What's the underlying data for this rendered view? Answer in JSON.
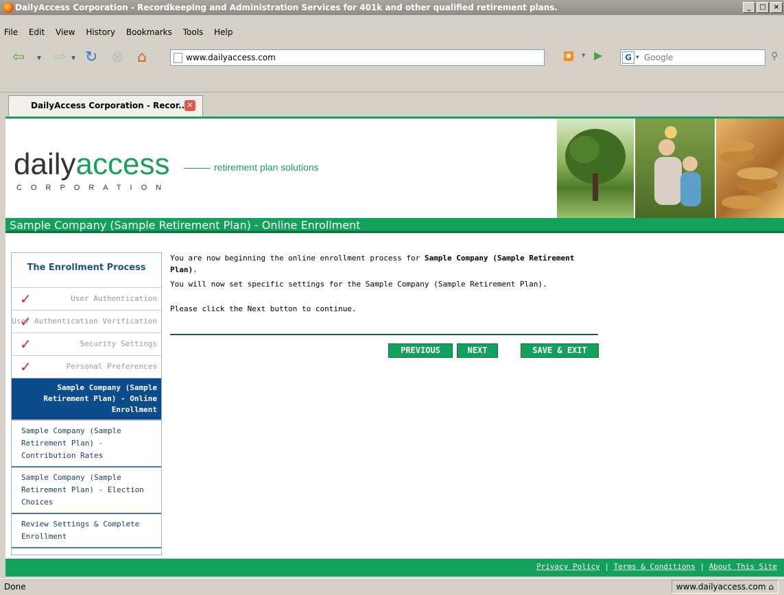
{
  "window": {
    "title": "DailyAccess Corporation - Recordkeeping and Administration Services for 401k and other qualified retirement plans.",
    "controls": [
      "_",
      "□",
      "×"
    ]
  },
  "menu": {
    "items": [
      "File",
      "Edit",
      "View",
      "History",
      "Bookmarks",
      "Tools",
      "Help"
    ]
  },
  "navigation": {
    "url": "www.dailyaccess.com",
    "search_placeholder": "Google"
  },
  "tabs": [
    {
      "label": "DailyAccess Corporation - Recor..."
    }
  ],
  "header": {
    "logo_daily": "daily",
    "logo_access": "access",
    "logo_corporation": "CORPORATION",
    "tagline": "retirement plan solutions"
  },
  "page_title": "Sample Company (Sample Retirement Plan) - Online Enrollment",
  "sidebar": {
    "heading": "The Enrollment Process",
    "completed_steps": [
      "User Authentication",
      "User Authentication Verification",
      "Security Settings",
      "Personal Preferences"
    ],
    "current_step": "Sample Company (Sample Retirement Plan) - Online Enrollment",
    "upcoming_steps": [
      "Sample Company (Sample Retirement Plan) - Contribution Rates",
      "Sample Company (Sample Retirement Plan) - Election Choices",
      "Review Settings & Complete Enrollment"
    ]
  },
  "content": {
    "line1_prefix": "You are now beginning the online enrollment process for ",
    "line1_bold": "Sample Company (Sample Retirement Plan)",
    "line1_suffix": ".",
    "line2": "You will now set specific settings for the Sample Company (Sample Retirement Plan).",
    "line3": "Please click the Next button to continue."
  },
  "buttons": {
    "previous": "PREVIOUS",
    "next": "NEXT",
    "save_exit": "SAVE & EXIT"
  },
  "footer": {
    "privacy": "Privacy Policy",
    "terms": "Terms & Conditions",
    "about": "About This Site",
    "separator": "|"
  },
  "status": {
    "left": "Done",
    "right": "www.dailyaccess.com"
  },
  "colors": {
    "brand_green": "#12a05a",
    "brand_blue": "#0b4c8c",
    "check_red": "#c8282c"
  }
}
